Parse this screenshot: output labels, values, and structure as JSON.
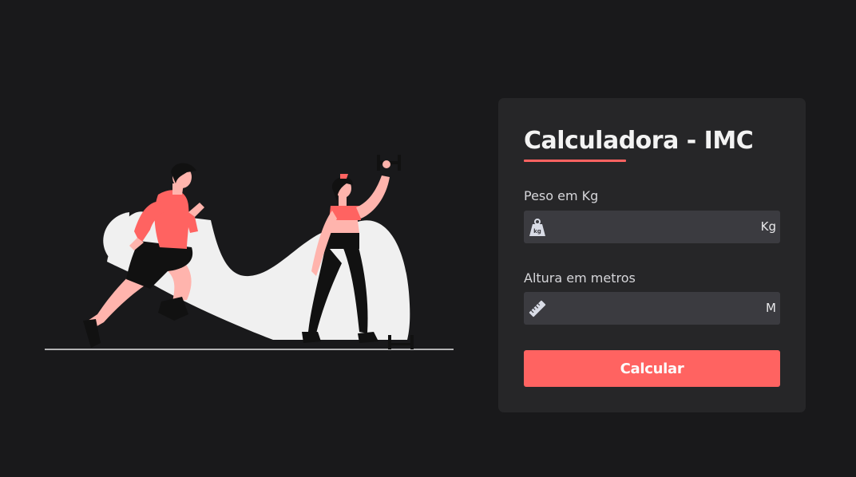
{
  "card": {
    "title": "Calculadora - IMC",
    "weight": {
      "label": "Peso em Kg",
      "value": "",
      "unit": "Kg",
      "icon": "weight-icon"
    },
    "height": {
      "label": "Altura em metros",
      "value": "",
      "unit": "M",
      "icon": "ruler-icon"
    },
    "button_label": "Calcular"
  },
  "colors": {
    "background": "#19191b",
    "card": "#262628",
    "field": "#3b3b40",
    "accent": "#ff6361",
    "text": "#f3f3f3",
    "label": "#d6d6da"
  },
  "illustration": {
    "subject": "fitness-people-illustration"
  }
}
